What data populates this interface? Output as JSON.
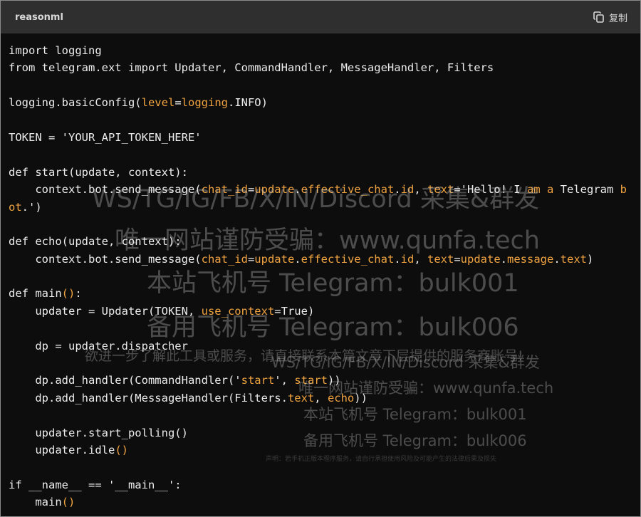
{
  "header": {
    "language": "reasonml",
    "copy_label": "复制"
  },
  "code": {
    "lines": [
      [
        {
          "t": "import logging"
        }
      ],
      [
        {
          "t": "from telegram.ext import Updater, CommandHandler, MessageHandler, Filters"
        }
      ],
      [],
      [
        {
          "t": "logging.basicConfig("
        },
        {
          "t": "level",
          "p": 1
        },
        {
          "t": "="
        },
        {
          "t": "logging",
          "p": 1
        },
        {
          "t": ".INFO)"
        }
      ],
      [],
      [
        {
          "t": "TOKEN = 'YOUR_API_TOKEN_HERE'"
        }
      ],
      [],
      [
        {
          "t": "def start(update, context):"
        }
      ],
      [
        {
          "t": "    context.bot.send_message("
        },
        {
          "t": "chat_id",
          "p": 1
        },
        {
          "t": "="
        },
        {
          "t": "update",
          "p": 1
        },
        {
          "t": "."
        },
        {
          "t": "effective_chat",
          "p": 1
        },
        {
          "t": "."
        },
        {
          "t": "id",
          "p": 1
        },
        {
          "t": ", "
        },
        {
          "t": "text",
          "p": 1
        },
        {
          "t": "='Hello! I "
        },
        {
          "t": "am",
          "p": 1
        },
        {
          "t": " "
        },
        {
          "t": "a",
          "p": 1
        },
        {
          "t": " Telegram "
        },
        {
          "t": "b",
          "p": 1
        }
      ],
      [
        {
          "t": "ot",
          "p": 1
        },
        {
          "t": ".')"
        }
      ],
      [],
      [
        {
          "t": "def echo(update, context):"
        }
      ],
      [
        {
          "t": "    context.bot.send_message("
        },
        {
          "t": "chat_id",
          "p": 1
        },
        {
          "t": "="
        },
        {
          "t": "update",
          "p": 1
        },
        {
          "t": "."
        },
        {
          "t": "effective_chat",
          "p": 1
        },
        {
          "t": "."
        },
        {
          "t": "id",
          "p": 1
        },
        {
          "t": ", "
        },
        {
          "t": "text",
          "p": 1
        },
        {
          "t": "="
        },
        {
          "t": "update",
          "p": 1
        },
        {
          "t": "."
        },
        {
          "t": "message",
          "p": 1
        },
        {
          "t": "."
        },
        {
          "t": "text",
          "p": 1
        },
        {
          "t": ")"
        }
      ],
      [],
      [
        {
          "t": "def main"
        },
        {
          "t": "()",
          "p": 1
        },
        {
          "t": ":"
        }
      ],
      [
        {
          "t": "    updater = Updater(TOKEN, "
        },
        {
          "t": "use_context",
          "p": 1
        },
        {
          "t": "=True)"
        }
      ],
      [],
      [
        {
          "t": "    dp = updater.dispatcher"
        }
      ],
      [],
      [
        {
          "t": "    dp.add_handler(CommandHandler('"
        },
        {
          "t": "start",
          "p": 1
        },
        {
          "t": "', "
        },
        {
          "t": "start",
          "p": 1
        },
        {
          "t": "))"
        }
      ],
      [
        {
          "t": "    dp.add_handler(MessageHandler(Filters."
        },
        {
          "t": "text",
          "p": 1
        },
        {
          "t": ", "
        },
        {
          "t": "echo",
          "p": 1
        },
        {
          "t": "))"
        }
      ],
      [],
      [
        {
          "t": "    updater.start_polling()"
        }
      ],
      [
        {
          "t": "    updater.idle"
        },
        {
          "t": "()",
          "p": 1
        }
      ],
      [],
      [
        {
          "t": "if __name__ == '__main__':"
        }
      ],
      [
        {
          "t": "    main"
        },
        {
          "t": "()",
          "p": 1
        }
      ]
    ]
  },
  "watermark": {
    "line1": "WS/TG/IG/FB/X/IN/Discord 采集&群发",
    "line2": "唯一网站谨防受骗：www.qunfa.tech",
    "line3": "本站飞机号 Telegram：bulk001",
    "line4": "备用飞机号 Telegram：bulk006",
    "line5": "欲进一步了解此工具或服务，请直接联系本篇文章下层提供的服务商账号!",
    "line6": "WS/TG/IG/FB/X/IN/Discord 采集&群发",
    "line7": "唯一网站谨防受骗：www.qunfa.tech",
    "line8": "本站飞机号 Telegram：bulk001",
    "line9": "备用飞机号 Telegram：bulk006",
    "line10": "声明：若手机正版本程序服务，请自行承担使用风险及可能产生的法律后果及损失"
  },
  "colors": {
    "background": "#0d0d0d",
    "header_bg": "#2f2f2f",
    "text": "#ececec",
    "param": "#f0a340"
  }
}
